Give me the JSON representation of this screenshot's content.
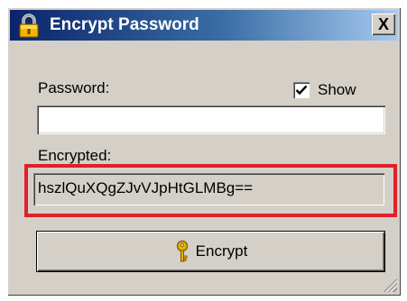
{
  "window": {
    "title": "Encrypt Password",
    "title_icon": "padlock-icon",
    "close_label": "X",
    "colors": {
      "titlebar_start": "#0a246a",
      "titlebar_end": "#a6caf0",
      "face": "#d4d0c8",
      "highlight_border": "#e0202a"
    }
  },
  "form": {
    "password_label": "Password:",
    "password_value": "",
    "show_label": "Show",
    "show_checked": true,
    "encrypted_label": "Encrypted:",
    "encrypted_value": "hszlQuXQgZJvVJpHtGLMBg=="
  },
  "button": {
    "encrypt_label": "Encrypt",
    "encrypt_icon": "key-icon"
  }
}
